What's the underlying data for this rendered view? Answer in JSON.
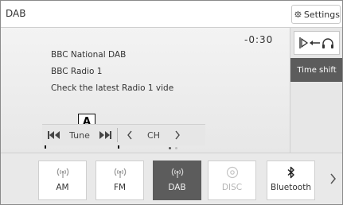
{
  "header": {
    "title": "DAB",
    "settings_label": "Settings"
  },
  "player": {
    "time": "-0:30",
    "station_name": "BBC National DAB",
    "programme": "BBC Radio 1",
    "info_text": "Check the latest Radio 1 vide"
  },
  "callout": {
    "label": "A"
  },
  "controls": {
    "tune_label": "Tune",
    "ch_label": "CH",
    "prev_icon": "skip-back-icon",
    "next_icon": "skip-forward-icon",
    "ch_prev_icon": "chevron-left-icon",
    "ch_next_icon": "chevron-right-icon"
  },
  "sidebar": {
    "source_icon": "speaker-headphones-icon",
    "timeshift_label": "Time shift"
  },
  "pagination": {
    "total": 2,
    "active_index": 0
  },
  "sources": [
    {
      "label": "AM",
      "icon": "radio-signal-icon",
      "state": "normal"
    },
    {
      "label": "FM",
      "icon": "radio-signal-icon",
      "state": "normal"
    },
    {
      "label": "DAB",
      "icon": "radio-signal-icon",
      "state": "active"
    },
    {
      "label": "DISC",
      "icon": "disc-icon",
      "state": "disabled"
    },
    {
      "label": "Bluetooth",
      "icon": "bluetooth-icon",
      "state": "normal"
    }
  ],
  "colors": {
    "active_tile": "#5c5c5c",
    "panel_bg": "#e7e7e7",
    "text": "#333333"
  }
}
